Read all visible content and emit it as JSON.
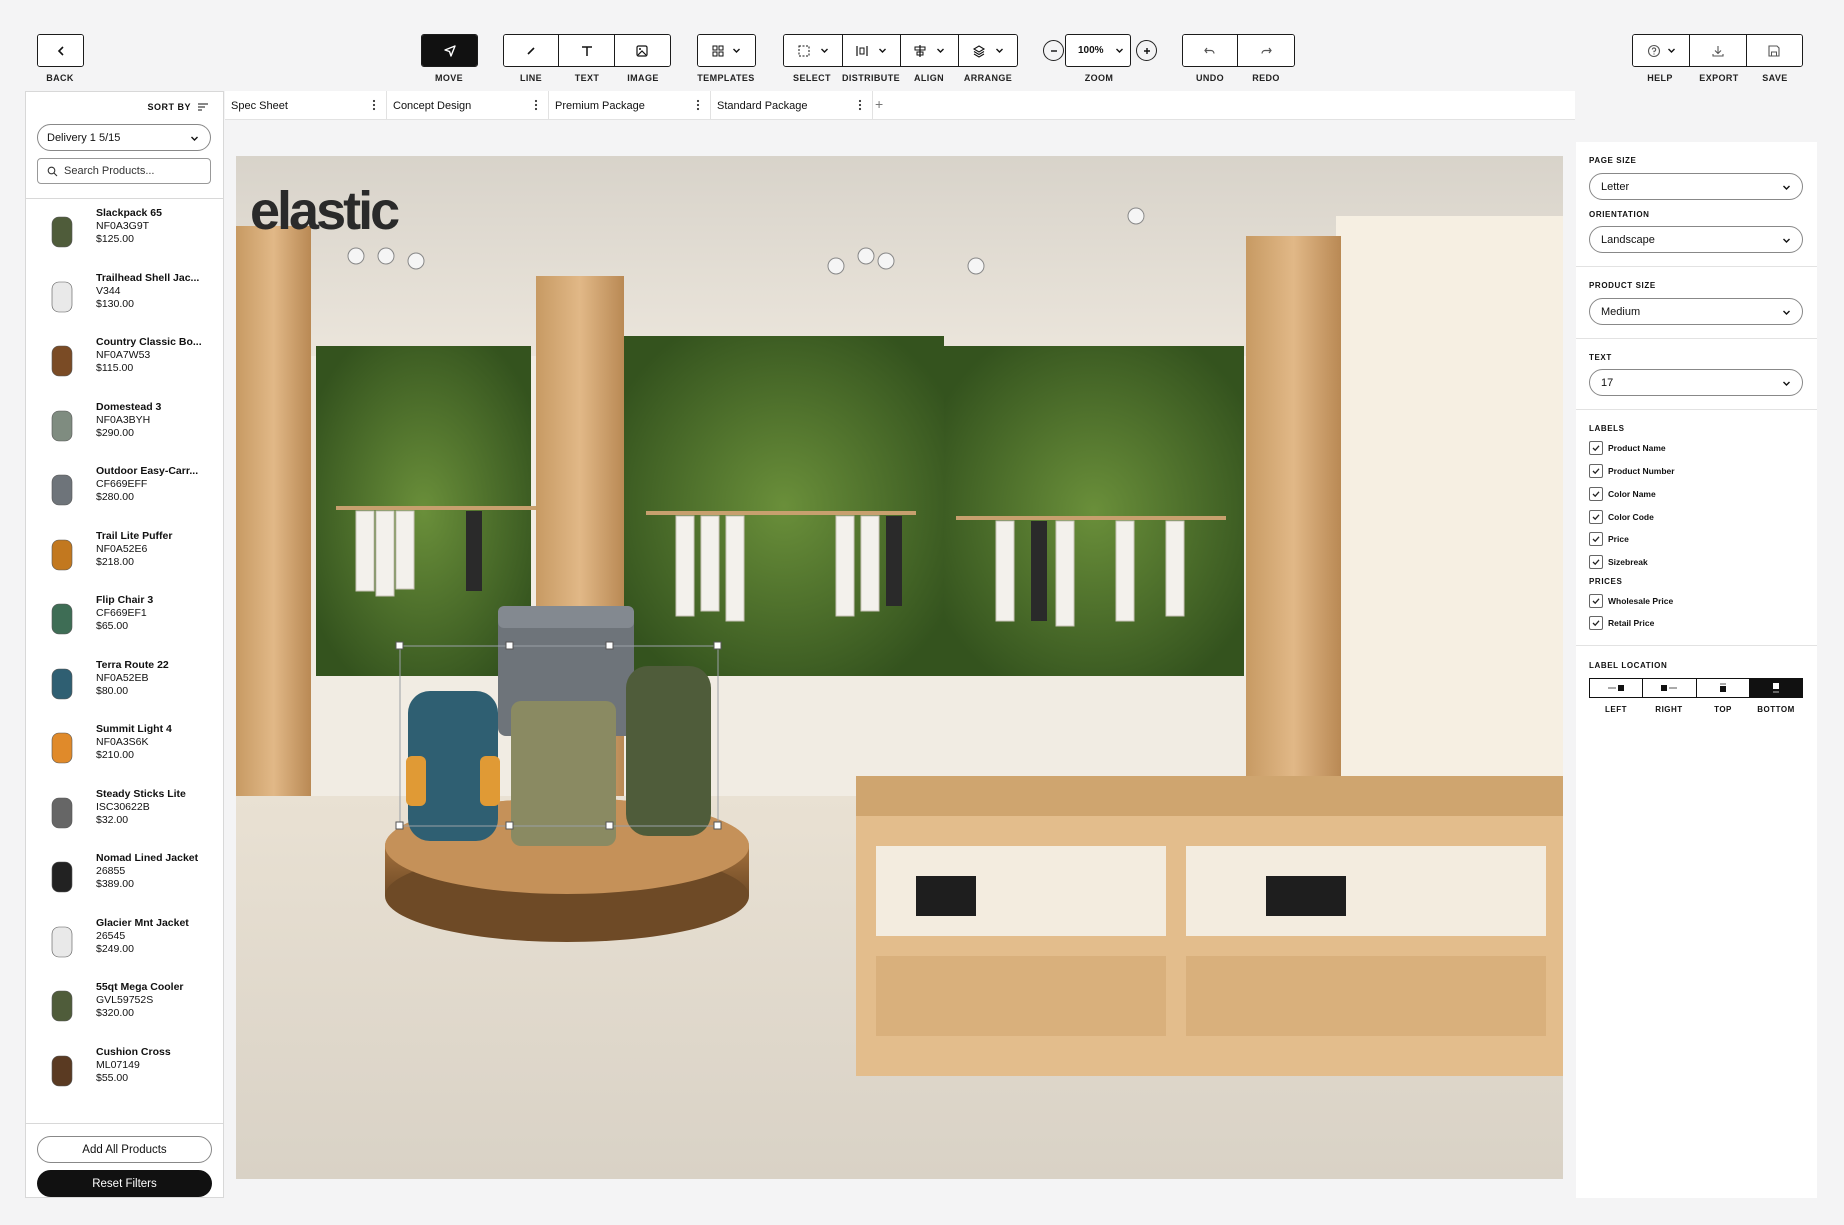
{
  "toolbar": {
    "back": "BACK",
    "move": "MOVE",
    "line": "LINE",
    "text": "TEXT",
    "image": "IMAGE",
    "templates": "TEMPLATES",
    "select": "SELECT",
    "distribute": "DISTRIBUTE",
    "align": "ALIGN",
    "arrange": "ARRANGE",
    "zoom": "ZOOM",
    "zoom_value": "100%",
    "undo": "UNDO",
    "redo": "REDO",
    "help": "HELP",
    "export": "EXPORT",
    "save": "SAVE"
  },
  "left_panel": {
    "sort_by": "SORT BY",
    "delivery": "Delivery 1 5/15",
    "search_placeholder": "Search Products...",
    "products": [
      {
        "name": "Slackpack 65",
        "code": "NF0A3G9T",
        "price": "$125.00",
        "icon": "backpack-green"
      },
      {
        "name": "Trailhead Shell Jac...",
        "code": "V344",
        "price": "$130.00",
        "icon": "jacket-white"
      },
      {
        "name": "Country Classic Bo...",
        "code": "NF0A7W53",
        "price": "$115.00",
        "icon": "boot-brown"
      },
      {
        "name": "Domestead 3",
        "code": "NF0A3BYH",
        "price": "$290.00",
        "icon": "tent-grey"
      },
      {
        "name": "Outdoor Easy-Carr...",
        "code": "CF669EFF",
        "price": "$280.00",
        "icon": "cooler-grey"
      },
      {
        "name": "Trail Lite Puffer",
        "code": "NF0A52E6",
        "price": "$218.00",
        "icon": "sleeping-bag"
      },
      {
        "name": "Flip Chair 3",
        "code": "CF669EF1",
        "price": "$65.00",
        "icon": "camp-chair"
      },
      {
        "name": "Terra Route 22",
        "code": "NF0A52EB",
        "price": "$80.00",
        "icon": "backpack-blue"
      },
      {
        "name": "Summit Light 4",
        "code": "NF0A3S6K",
        "price": "$210.00",
        "icon": "tent-orange"
      },
      {
        "name": "Steady Sticks Lite",
        "code": "ISC30622B",
        "price": "$32.00",
        "icon": "trekking-poles"
      },
      {
        "name": "Nomad Lined Jacket",
        "code": "26855",
        "price": "$389.00",
        "icon": "jacket-black"
      },
      {
        "name": "Glacier Mnt Jacket",
        "code": "26545",
        "price": "$249.00",
        "icon": "jacket-white"
      },
      {
        "name": "55qt Mega Cooler",
        "code": "GVL59752S",
        "price": "$320.00",
        "icon": "cooler-green"
      },
      {
        "name": "Cushion Cross",
        "code": "ML07149",
        "price": "$55.00",
        "icon": "sandal"
      }
    ],
    "add_all": "Add All Products",
    "reset": "Reset Filters"
  },
  "tabs": [
    {
      "label": "Spec Sheet"
    },
    {
      "label": "Concept Design"
    },
    {
      "label": "Premium Package"
    },
    {
      "label": "Standard Package"
    }
  ],
  "canvas": {
    "logo": "elastic"
  },
  "right_panel": {
    "page_size_label": "PAGE SIZE",
    "page_size": "Letter",
    "orientation_label": "ORIENTATION",
    "orientation": "Landscape",
    "product_size_label": "PRODUCT SIZE",
    "product_size": "Medium",
    "text_label": "TEXT",
    "text_size": "17",
    "labels_heading": "LABELS",
    "labels": [
      {
        "label": "Product Name",
        "checked": true
      },
      {
        "label": "Product Number",
        "checked": true
      },
      {
        "label": "Color Name",
        "checked": true
      },
      {
        "label": "Color Code",
        "checked": true
      },
      {
        "label": "Price",
        "checked": true
      },
      {
        "label": "Sizebreak",
        "checked": true
      }
    ],
    "prices_heading": "PRICES",
    "prices": [
      {
        "label": "Wholesale Price",
        "checked": true
      },
      {
        "label": "Retail Price",
        "checked": true
      }
    ],
    "label_location_heading": "LABEL LOCATION",
    "label_locations": [
      "LEFT",
      "RIGHT",
      "TOP",
      "BOTTOM"
    ],
    "label_location_selected": "BOTTOM"
  }
}
